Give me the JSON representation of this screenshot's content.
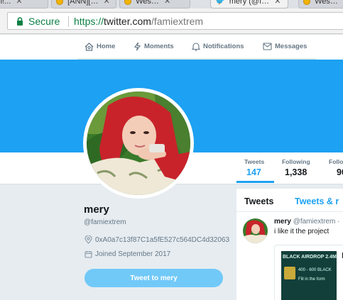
{
  "browser": {
    "tabs": [
      {
        "label": "n!...",
        "icon": "page-icon"
      },
      {
        "label": "[ANN][…",
        "icon": "bitcoin-favicon-icon"
      },
      {
        "label": "Wes…",
        "icon": "bitcoin-favicon-icon"
      },
      {
        "label": "mery (@f…",
        "icon": "twitter-bird-icon"
      },
      {
        "label": "Wes…",
        "icon": "bitcoin-favicon-icon"
      }
    ],
    "security_label": "Secure",
    "url": {
      "scheme": "https://",
      "host": "twitter.com",
      "path": "/famiextrem"
    }
  },
  "topnav": {
    "home": "Home",
    "moments": "Moments",
    "notifications": "Notifications",
    "messages": "Messages"
  },
  "profile_nav": {
    "tweets": {
      "label": "Tweets",
      "value": "147"
    },
    "following": {
      "label": "Following",
      "value": "1,338"
    },
    "followers": {
      "label": "Follo",
      "value": "90"
    }
  },
  "profile": {
    "name": "mery",
    "handle": "@famiextrem",
    "location": "0xA0a7c13f87C1a5fE527c564DC4d32063",
    "joined": "Joined September 2017",
    "tweet_button": "Tweet to mery"
  },
  "timeline": {
    "tab_tweets": "Tweets",
    "tab_replies": "Tweets & r",
    "tweet": {
      "name": "mery",
      "handle": "@famiextrem",
      "separator": "·",
      "text": "i like it the project",
      "card": {
        "title": "BLACK AIRDROP 2.4M",
        "line1": "400 - 600 BLACK",
        "line2": "Fill in the form"
      }
    }
  },
  "colors": {
    "twitter_blue": "#1da1f2",
    "secure_green": "#0b8043",
    "tweet_button": "#71c9f8",
    "page_bg": "#e6ecf0"
  }
}
